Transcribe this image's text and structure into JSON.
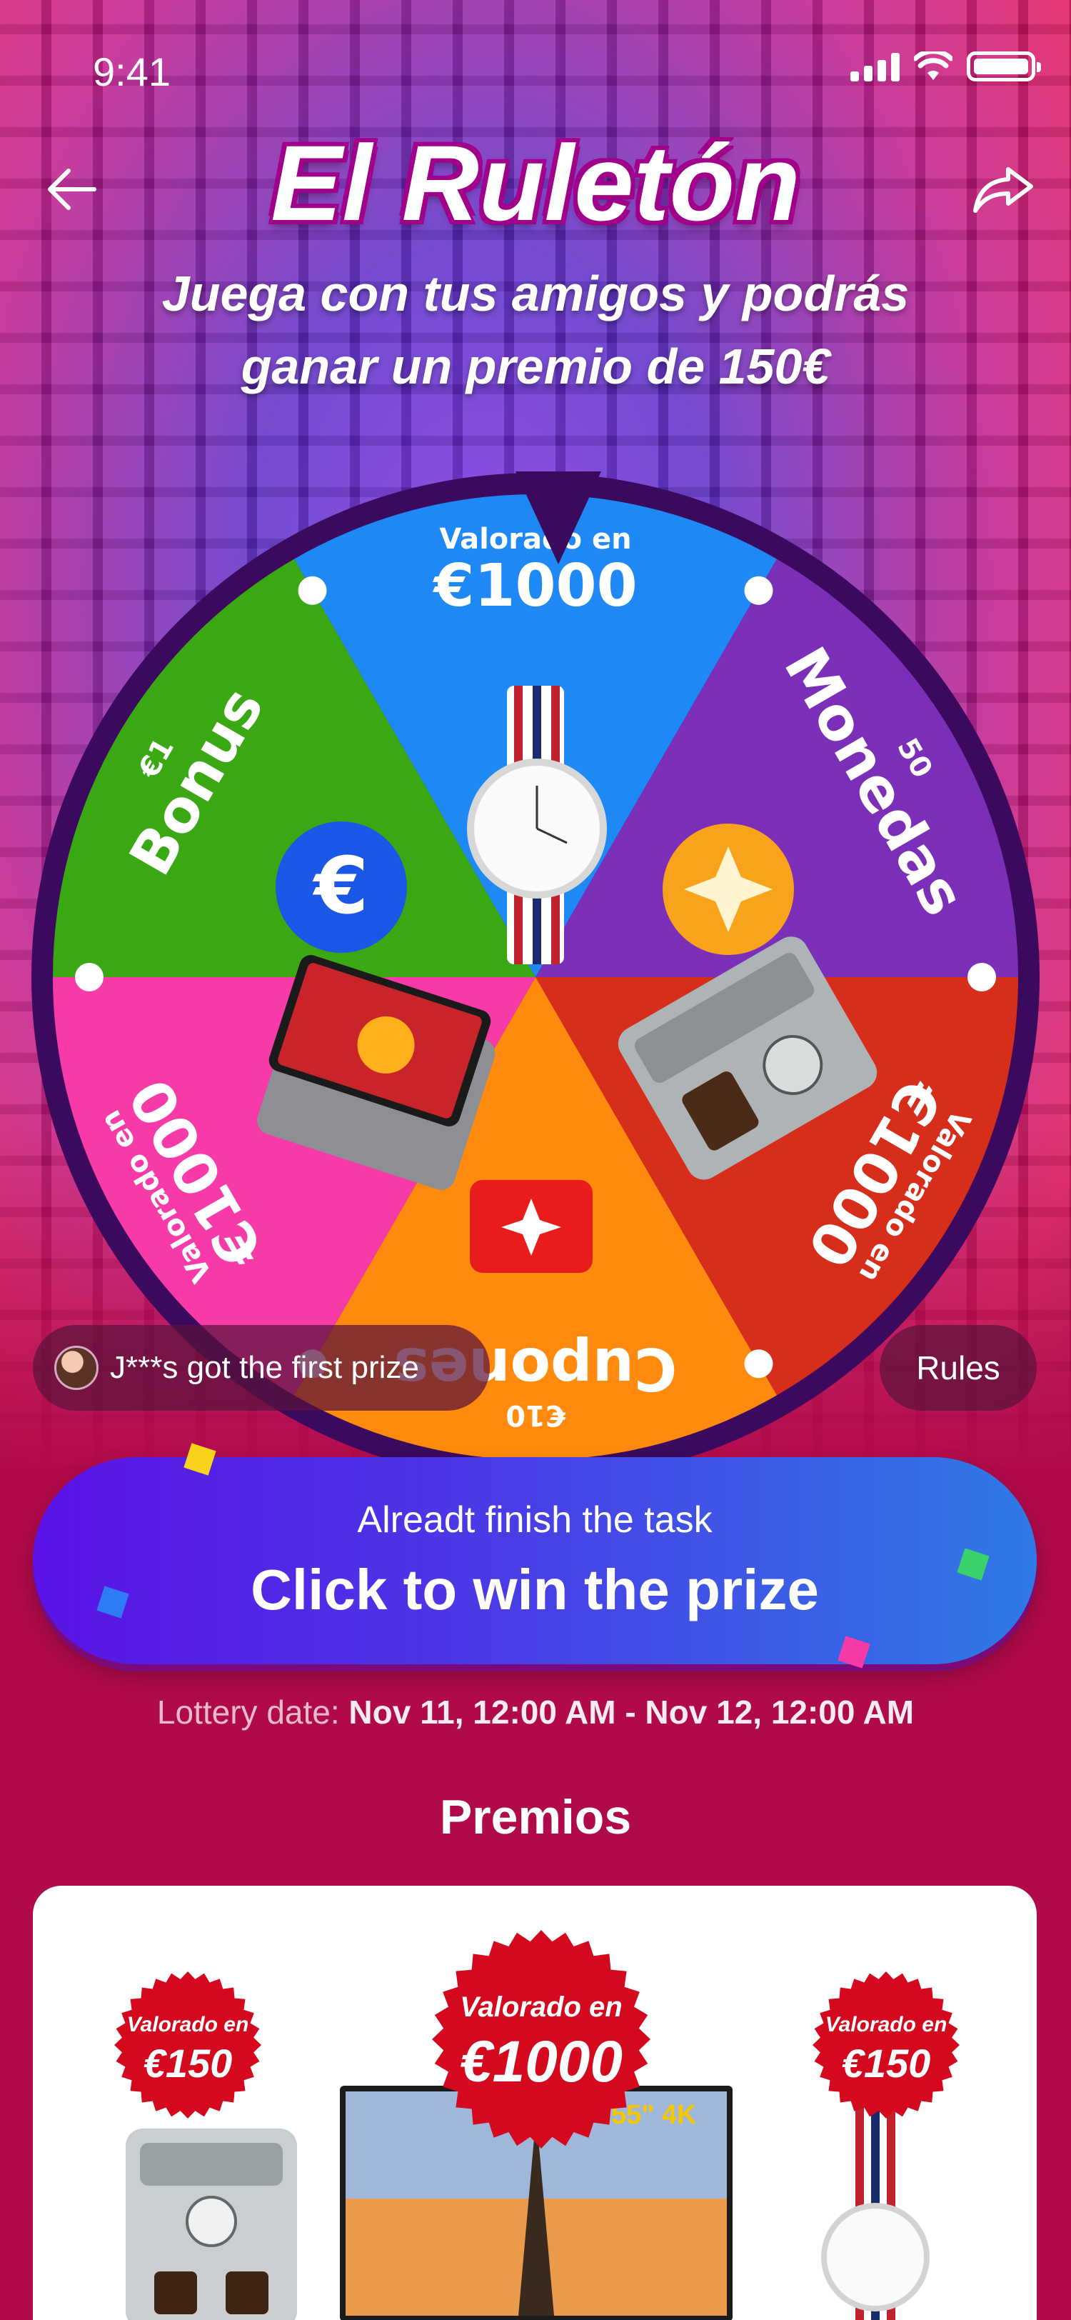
{
  "status_bar": {
    "time": "9:41"
  },
  "header": {
    "title": "El Ruletón",
    "subtitle_line1": "Juega con tus amigos y podrás",
    "subtitle_line2": "ganar un premio de 150€",
    "back_icon": "arrow-left-icon",
    "share_icon": "share-icon"
  },
  "wheel": {
    "segments": [
      {
        "id": "watch",
        "line1": "Valorado en",
        "line2": "€1000",
        "color": "#1e88f5"
      },
      {
        "id": "coins",
        "line1": "50",
        "line2": "Monedas",
        "color": "#7b2fb8"
      },
      {
        "id": "coffee",
        "line1": "Valorado en",
        "line2": "€1000",
        "color": "#d62e1a"
      },
      {
        "id": "coupons",
        "line1": "€10",
        "line2": "Cupones",
        "color": "#ff8a0d"
      },
      {
        "id": "phone",
        "line1": "Valorado en",
        "line2": "€1000",
        "color": "#f73aa8"
      },
      {
        "id": "bonus",
        "line1": "€1",
        "line2": "Bonus",
        "color": "#3aa812"
      }
    ]
  },
  "ticker": {
    "text": "J***s got the first prize"
  },
  "rules": {
    "label": "Rules"
  },
  "cta": {
    "subtitle": "Alreadt finish the task",
    "label": "Click to win the prize"
  },
  "lottery": {
    "label": "Lottery date: ",
    "value": "Nov 11, 12:00 AM - Nov 12, 12:00 AM"
  },
  "premios": {
    "title": "Premios",
    "badges": [
      {
        "line1": "Valorado en",
        "line2": "€150"
      },
      {
        "line1": "Valorado en",
        "line2": "€1000"
      },
      {
        "line1": "Valorado en",
        "line2": "€150"
      }
    ],
    "tv_label": "55\" 4K"
  },
  "colors": {
    "badge_red": "#d5091e",
    "cta_start": "#5a12e6",
    "cta_end": "#2f7ae6",
    "background": "#b00a4a"
  }
}
